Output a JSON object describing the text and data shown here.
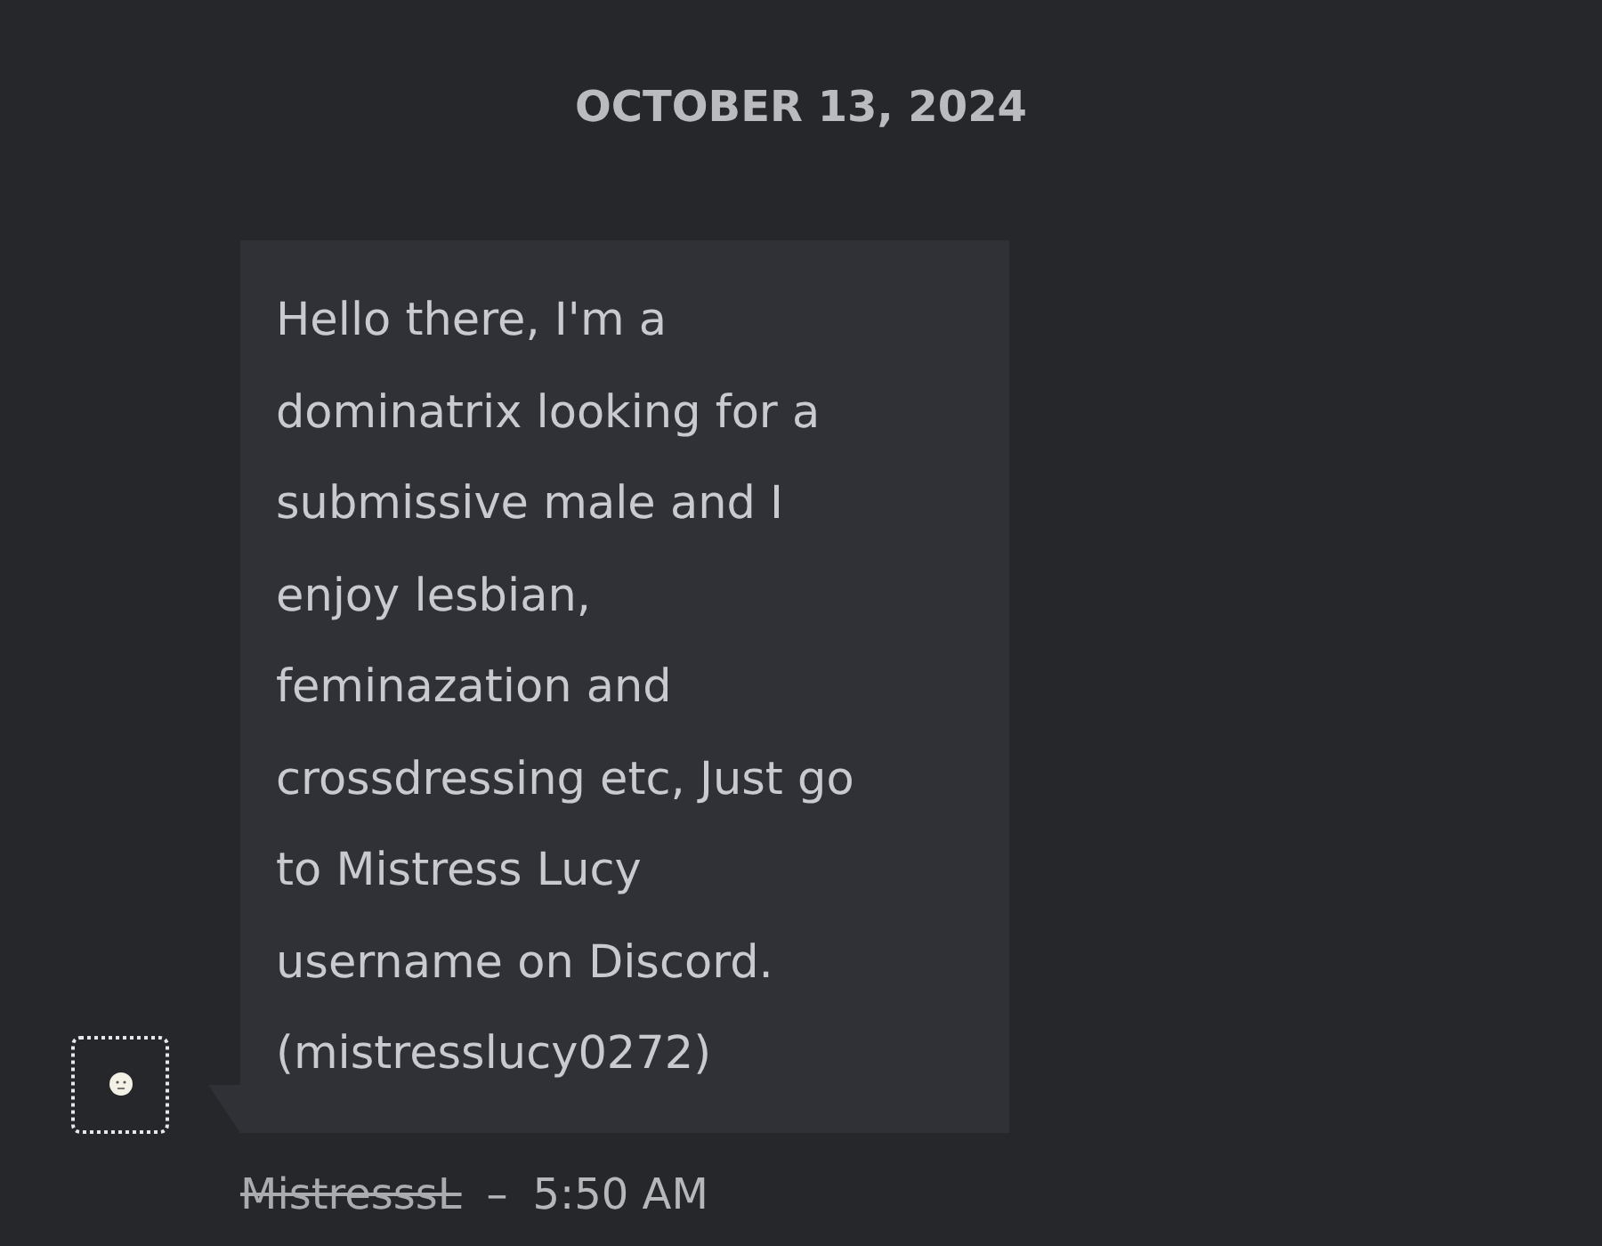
{
  "date_divider": "OCTOBER 13, 2024",
  "message": {
    "lines": [
      "Hello there, I'm a",
      "dominatrix looking for a",
      "submissive male and I",
      "enjoy lesbian,",
      "feminazation and",
      "crossdressing etc, Just go",
      "to Mistress Lucy",
      "username on Discord.",
      "(mistresslucy0272)"
    ],
    "sender": {
      "name": "MistresssL",
      "struck_out": true
    },
    "separator": "–",
    "time": "5:50 AM"
  }
}
